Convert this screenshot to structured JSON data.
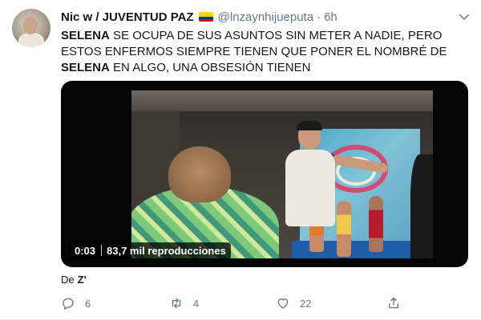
{
  "tweet": {
    "display_name": "Nic w / JUVENTUD PAZ",
    "flag_icon": "colombia-flag-icon",
    "handle": "@lnzaynhijueputa",
    "separator": "·",
    "time": "6h",
    "text_parts": [
      {
        "text": "SELENA",
        "bold": true
      },
      {
        "text": " SE OCUPA DE SUS ASUNTOS SIN METER A NADIE, PERO ESTOS ENFERMOS SIEMPRE TIENEN QUE PONER EL NOMBRÉ DE ",
        "bold": false
      },
      {
        "text": "SELENA",
        "bold": true
      },
      {
        "text": " EN ALGO, UNA OBSESIÓN TIENEN",
        "bold": false
      }
    ],
    "video": {
      "duration": "0:03",
      "views": "83,7 mil reproducciones"
    },
    "source_prefix": "De",
    "source_name": "Z'",
    "actions": {
      "reply_count": "6",
      "retweet_count": "4",
      "like_count": "22"
    },
    "colors": {
      "text": "#14171a",
      "muted": "#657786",
      "divider": "#e6ecf0"
    }
  }
}
